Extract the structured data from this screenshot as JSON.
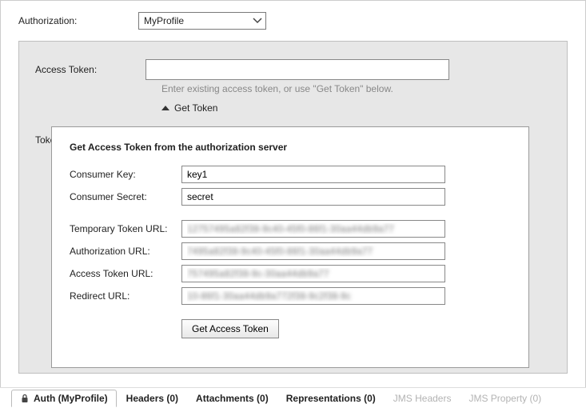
{
  "header": {
    "authorization_label": "Authorization:",
    "profile_selected": "MyProfile"
  },
  "panel": {
    "access_token_label": "Access Token:",
    "access_token_value": "",
    "access_token_hint": "Enter existing access token, or use \"Get Token\" below.",
    "get_token_toggle": "Get Token",
    "hidden_row_label": "Token Secret:"
  },
  "popup": {
    "title": "Get Access Token from the authorization server",
    "fields": {
      "consumer_key_label": "Consumer Key:",
      "consumer_key_value": "key1",
      "consumer_secret_label": "Consumer Secret:",
      "consumer_secret_value": "secret",
      "temp_token_label": "Temporary Token URL:",
      "temp_token_value": "12757495a82f38-9c40-45f0-86f1-30aa44db9a77",
      "auth_url_label": "Authorization URL:",
      "auth_url_value": "7495a82f38-9c40-45f0-86f1-30aa44db9a77",
      "access_url_label": "Access Token URL:",
      "access_url_value": "757495a82f38-9c-30aa44db9a77",
      "redirect_label": "Redirect URL:",
      "redirect_value": "10-86f1-30aa44db9a772f38-9c2f38-9c"
    },
    "button": "Get Access Token"
  },
  "tabs": {
    "auth": "Auth (MyProfile)",
    "headers": "Headers (0)",
    "attachments": "Attachments (0)",
    "representations": "Representations (0)",
    "jms_headers": "JMS Headers",
    "jms_property": "JMS Property (0)"
  }
}
